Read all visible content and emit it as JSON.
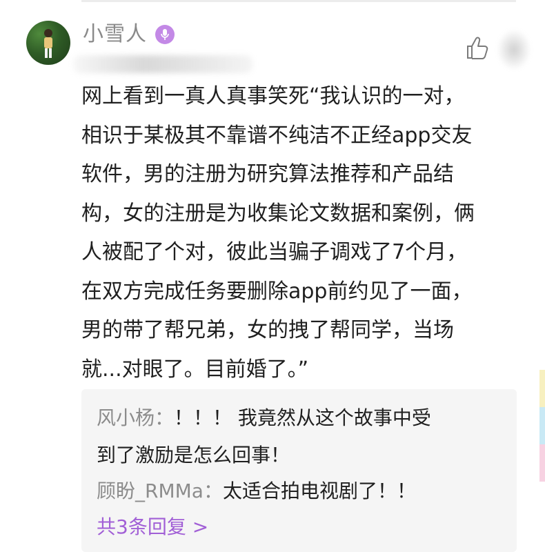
{
  "comment": {
    "username": "小雪人",
    "icons": {
      "avatar": "user-avatar-photo",
      "badge": "microphone-icon",
      "like": "thumbs-up-icon"
    },
    "body_lines": [
      "网上看到一真人真事笑死“我认识的一对，",
      "相识于某极其不靠谱不纯洁不正经app交友",
      "软件，男的注册为研究算法推荐和产品结",
      "构，女的注册是为收集论文数据和案例，俩",
      "人被配了个对，彼此当骗子调戏了7个月，",
      "在双方完成任务要删除app前约见了一面，",
      "男的带了帮兄弟，女的拽了帮同学，当场",
      "就...对眼了。目前婚了。”"
    ]
  },
  "replies": [
    {
      "name": "风小杨",
      "sep": "：",
      "text_line1": "！！！ 我竟然从这个故事中受",
      "text_line2": "到了激励是怎么回事！"
    },
    {
      "name": "顾盼_RMMa",
      "sep": "：",
      "text_line1": "太适合拍电视剧了！！"
    }
  ],
  "more_replies_label": "共3条回复 >",
  "colors": {
    "accent": "#a15fd6",
    "badge": "#c389e6",
    "reply_background": "#f5f5f5",
    "side_strip": [
      "#f7f0c0",
      "#c9e9f5",
      "#f7d2e2"
    ]
  }
}
